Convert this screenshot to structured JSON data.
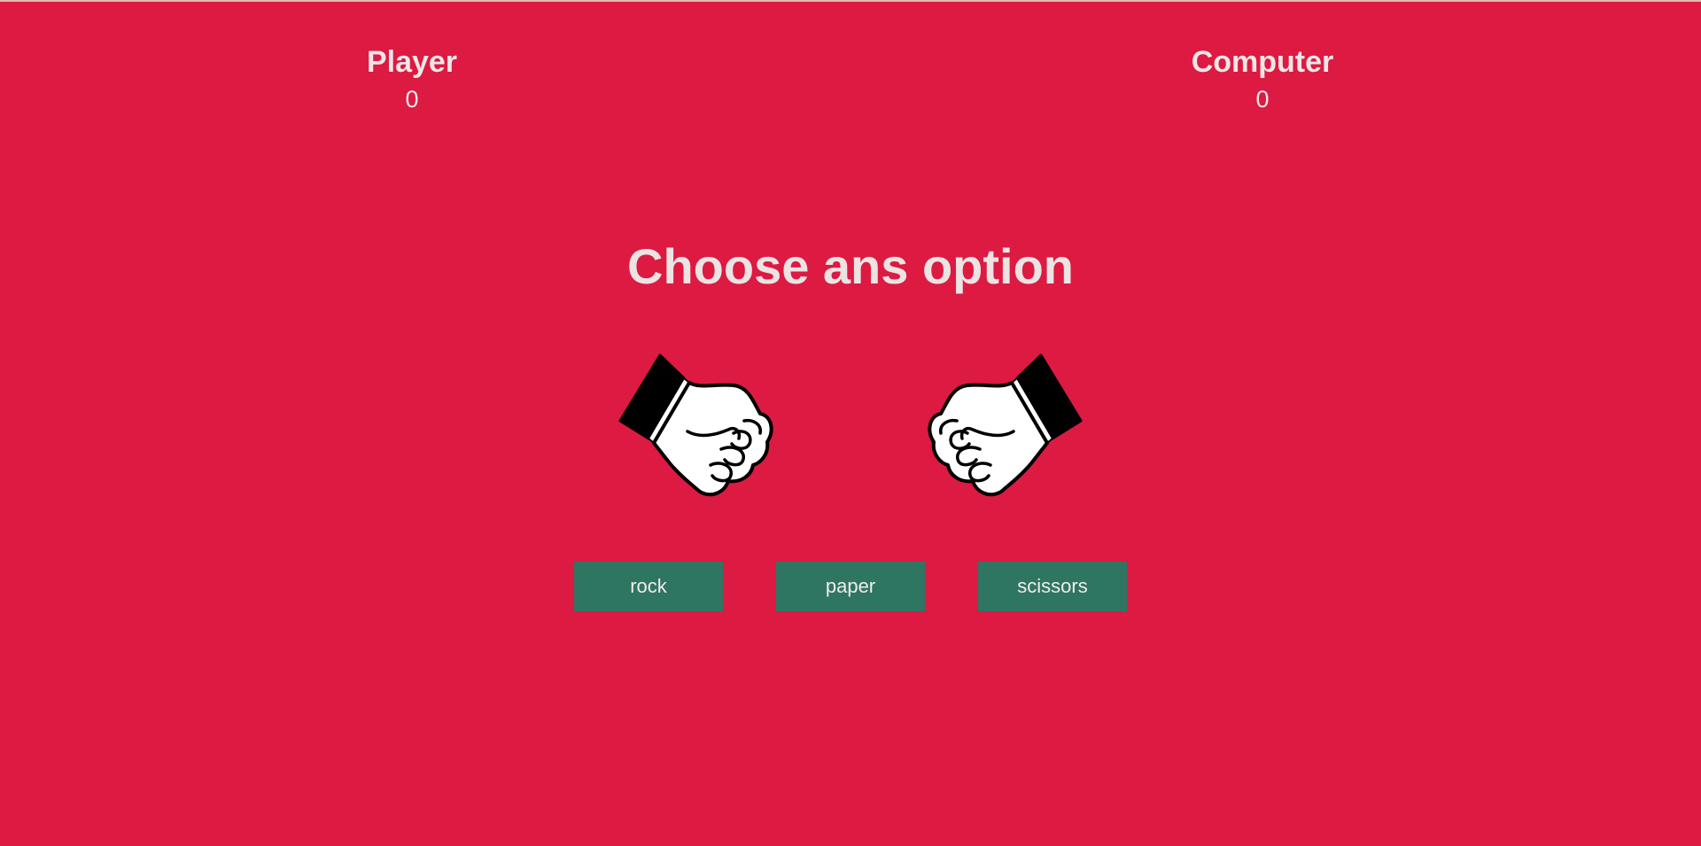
{
  "scores": {
    "player": {
      "label": "Player",
      "value": "0"
    },
    "computer": {
      "label": "Computer",
      "value": "0"
    }
  },
  "prompt": "Choose ans option",
  "hands": {
    "player": "rock-fist-icon",
    "computer": "rock-fist-icon"
  },
  "buttons": [
    {
      "label": "rock"
    },
    {
      "label": "paper"
    },
    {
      "label": "scissors"
    }
  ],
  "colors": {
    "background": "#dc1a42",
    "button": "#2e7562",
    "text": "#efe6e6"
  }
}
